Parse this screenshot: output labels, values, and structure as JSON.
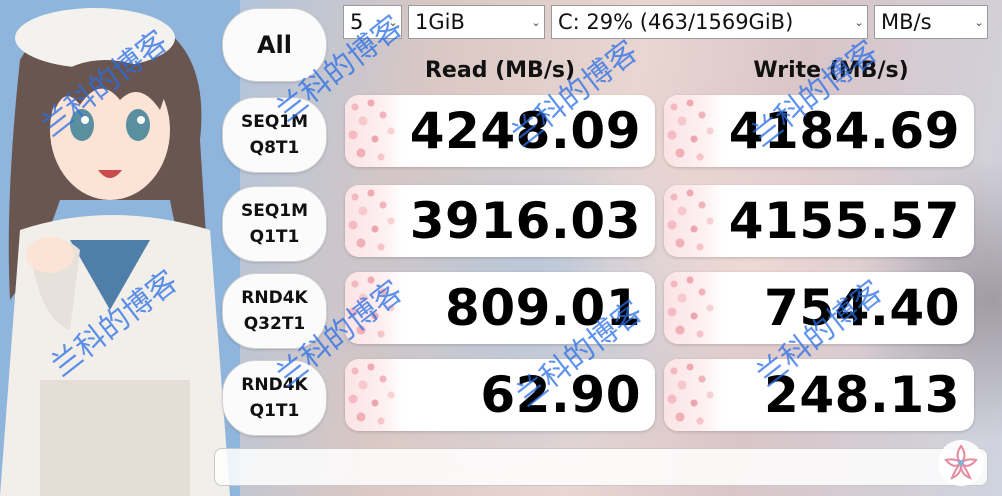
{
  "controls": {
    "count": "5",
    "size": "1GiB",
    "drive": "C: 29% (463/1569GiB)",
    "unit": "MB/s",
    "all_label": "All"
  },
  "headers": {
    "read": "Read (MB/s)",
    "write": "Write (MB/s)"
  },
  "tests": [
    {
      "line1": "SEQ1M",
      "line2": "Q8T1",
      "read": "4248.09",
      "write": "4184.69"
    },
    {
      "line1": "SEQ1M",
      "line2": "Q1T1",
      "read": "3916.03",
      "write": "4155.57"
    },
    {
      "line1": "RND4K",
      "line2": "Q32T1",
      "read": "809.01",
      "write": "754.40"
    },
    {
      "line1": "RND4K",
      "line2": "Q1T1",
      "read": "62.90",
      "write": "248.13"
    }
  ],
  "status": "",
  "watermark": "兰科的博客",
  "colors": {
    "watermark": "#286ee6",
    "panel": "#ffffff",
    "flower": "#f0a9b1"
  },
  "icons": {
    "dropdown": "chevron-down-icon",
    "logo": "flower-logo-icon"
  }
}
